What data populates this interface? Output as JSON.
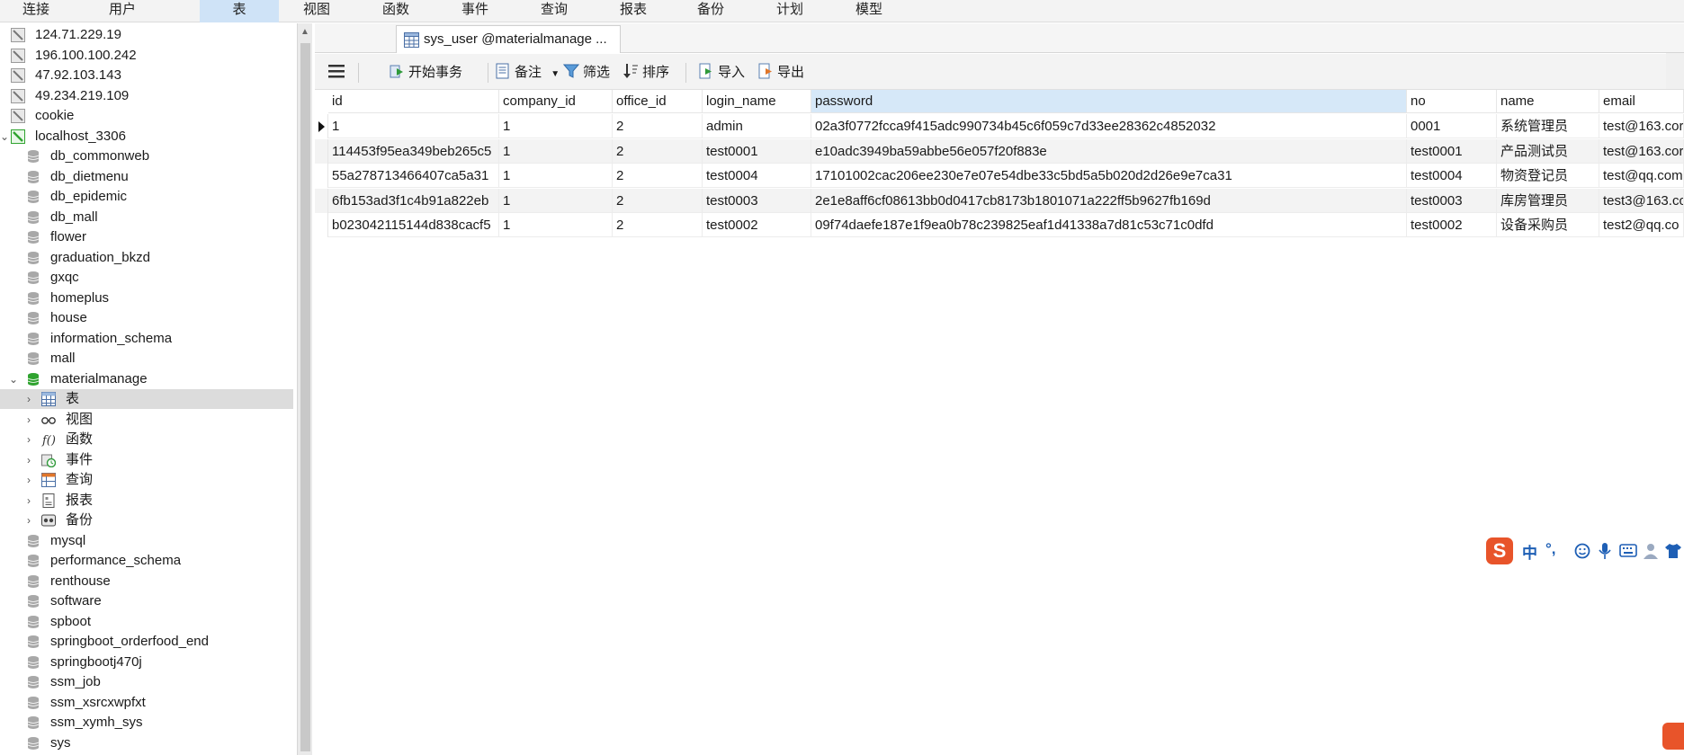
{
  "menu": {
    "items": [
      "连接",
      "用户",
      "表",
      "视图",
      "函数",
      "事件",
      "查询",
      "报表",
      "备份",
      "计划",
      "模型"
    ],
    "active": "表"
  },
  "sidebar": {
    "connections": [
      "124.71.229.19",
      "196.100.100.242",
      "47.92.103.143",
      "49.234.219.109",
      "cookie"
    ],
    "localhost": "localhost_3306",
    "databases_before": [
      "db_commonweb",
      "db_dietmenu",
      "db_epidemic",
      "db_mall",
      "flower",
      "graduation_bkzd",
      "gxqc",
      "homeplus",
      "house",
      "information_schema",
      "mall"
    ],
    "open_database": "materialmanage",
    "open_children": [
      "表",
      "视图",
      "函数",
      "事件",
      "查询",
      "报表",
      "备份"
    ],
    "databases_after": [
      "mysql",
      "performance_schema",
      "renthouse",
      "software",
      "spboot",
      "springboot_orderfood_end",
      "springbootj470j",
      "ssm_job",
      "ssm_xsrcxwpfxt",
      "ssm_xymh_sys",
      "sys"
    ]
  },
  "tab": {
    "label": "sys_user @materialmanage ..."
  },
  "toolbar": {
    "begin_transaction": "开始事务",
    "memo": "备注",
    "filter": "筛选",
    "sort": "排序",
    "import": "导入",
    "export": "导出"
  },
  "grid": {
    "columns": [
      "id",
      "company_id",
      "office_id",
      "login_name",
      "password",
      "no",
      "name",
      "email"
    ],
    "rows": [
      [
        "1",
        "1",
        "2",
        "admin",
        "02a3f0772fcca9f415adc990734b45c6f059c7d33ee28362c4852032",
        "0001",
        "系统管理员",
        "test@163.cor"
      ],
      [
        "114453f95ea349beb265c5",
        "1",
        "2",
        "test0001",
        "e10adc3949ba59abbe56e057f20f883e",
        "test0001",
        "产品测试员",
        "test@163.cor"
      ],
      [
        "55a278713466407ca5a31",
        "1",
        "2",
        "test0004",
        "17101002cac206ee230e7e07e54dbe33c5bd5a5b020d2d26e9e7ca31",
        "test0004",
        "物资登记员",
        "test@qq.com"
      ],
      [
        "6fb153ad3f1c4b91a822eb",
        "1",
        "2",
        "test0003",
        "2e1e8aff6cf08613bb0d0417cb8173b1801071a222ff5b9627fb169d",
        "test0003",
        "库房管理员",
        "test3@163.co"
      ],
      [
        "b023042115144d838cacf5",
        "1",
        "2",
        "test0002",
        "09f74daefe187e1f9ea0b78c239825eaf1d41338a7d81c53c71c0dfd",
        "test0002",
        "设备采购员",
        "test2@qq.co"
      ]
    ]
  },
  "ime": {
    "lang": "中",
    "punct": "°,"
  },
  "colors": {
    "menu_active": "#cfe3f7",
    "header_active": "#d6e8f8",
    "ime_brand": "#e8542a",
    "db_green": "#2fa32f"
  }
}
